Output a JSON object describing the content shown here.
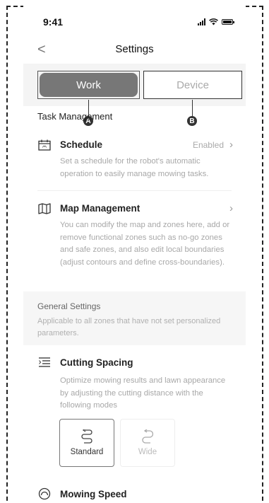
{
  "status_bar": {
    "time": "9:41"
  },
  "nav": {
    "back_glyph": "<",
    "title": "Settings"
  },
  "tabs": [
    {
      "label": "Work",
      "selected": true
    },
    {
      "label": "Device",
      "selected": false
    }
  ],
  "callouts": {
    "a": "A",
    "b": "B"
  },
  "task_management": {
    "heading": "Task Management",
    "schedule": {
      "icon": "calendar-icon",
      "title": "Schedule",
      "status": "Enabled",
      "description": "Set a schedule for the robot's automatic operation to easily manage mowing tasks."
    },
    "map_management": {
      "icon": "map-icon",
      "title": "Map Management",
      "description": "You can modify the map and zones here, add or remove functional zones such as no-go zones and safe zones, and also edit local boundaries (adjust contours and define cross-boundaries)."
    }
  },
  "general_settings": {
    "heading": "General Settings",
    "subtitle": "Applicable to all zones that have not set personalized parameters."
  },
  "cutting_spacing": {
    "icon": "list-lines-icon",
    "title": "Cutting Spacing",
    "description": "Optimize mowing results and lawn appearance by adjusting the cutting distance with the following modes",
    "modes": [
      {
        "label": "Standard",
        "icon": "standard-path-icon",
        "selected": true
      },
      {
        "label": "Wide",
        "icon": "wide-path-icon",
        "selected": false
      }
    ]
  },
  "mowing_speed": {
    "icon": "speed-gauge-icon",
    "title": "Mowing Speed"
  },
  "colors": {
    "selected_tab": "#777777",
    "muted_text": "#a8a8a8",
    "section_bg": "#f6f6f6"
  }
}
